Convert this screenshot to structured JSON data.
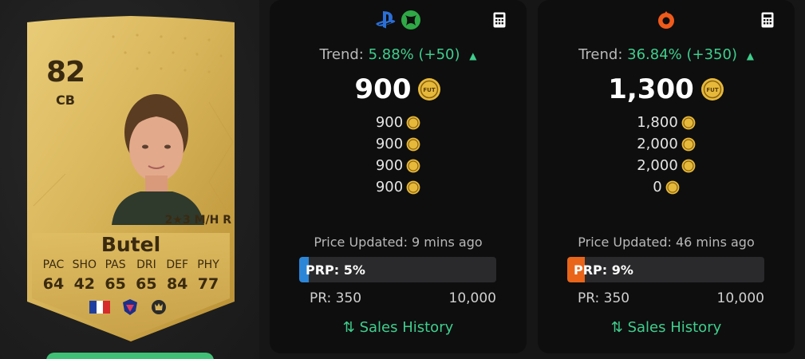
{
  "card": {
    "rating": "82",
    "position": "CB",
    "skills": "2★3 M/H R",
    "name": "Butel",
    "stat_labels": [
      "PAC",
      "SHO",
      "PAS",
      "DRI",
      "DEF",
      "PHY"
    ],
    "stat_values": [
      "64",
      "42",
      "65",
      "65",
      "84",
      "77"
    ],
    "badges": [
      "france-flag-icon",
      "league-badge-icon",
      "club-badge-icon"
    ]
  },
  "console_panel": {
    "platform_icons": [
      "playstation-icon",
      "xbox-icon"
    ],
    "trend_label": "Trend:",
    "trend_value": "5.88% (+50)",
    "trend_direction": "up",
    "price": "900",
    "recent_prices": [
      "900",
      "900",
      "900",
      "900"
    ],
    "updated": "Price Updated: 9 mins ago",
    "prp_label": "PRP: 5%",
    "prp_percent": 5,
    "pr_min": "PR: 350",
    "pr_max": "10,000",
    "sales_history": "Sales History"
  },
  "pc_panel": {
    "platform_icons": [
      "origin-icon"
    ],
    "trend_label": "Trend:",
    "trend_value": "36.84% (+350)",
    "trend_direction": "up",
    "price": "1,300",
    "recent_prices": [
      "1,800",
      "2,000",
      "2,000",
      "0"
    ],
    "updated": "Price Updated: 46 mins ago",
    "prp_label": "PRP: 9%",
    "prp_percent": 9,
    "pr_min": "PR: 350",
    "pr_max": "10,000",
    "sales_history": "Sales History"
  },
  "colors": {
    "trend_green": "#3fce8c",
    "ps_bar": "#2c86d8",
    "pc_bar": "#e8651a",
    "card_gold": "#d8b55a"
  }
}
